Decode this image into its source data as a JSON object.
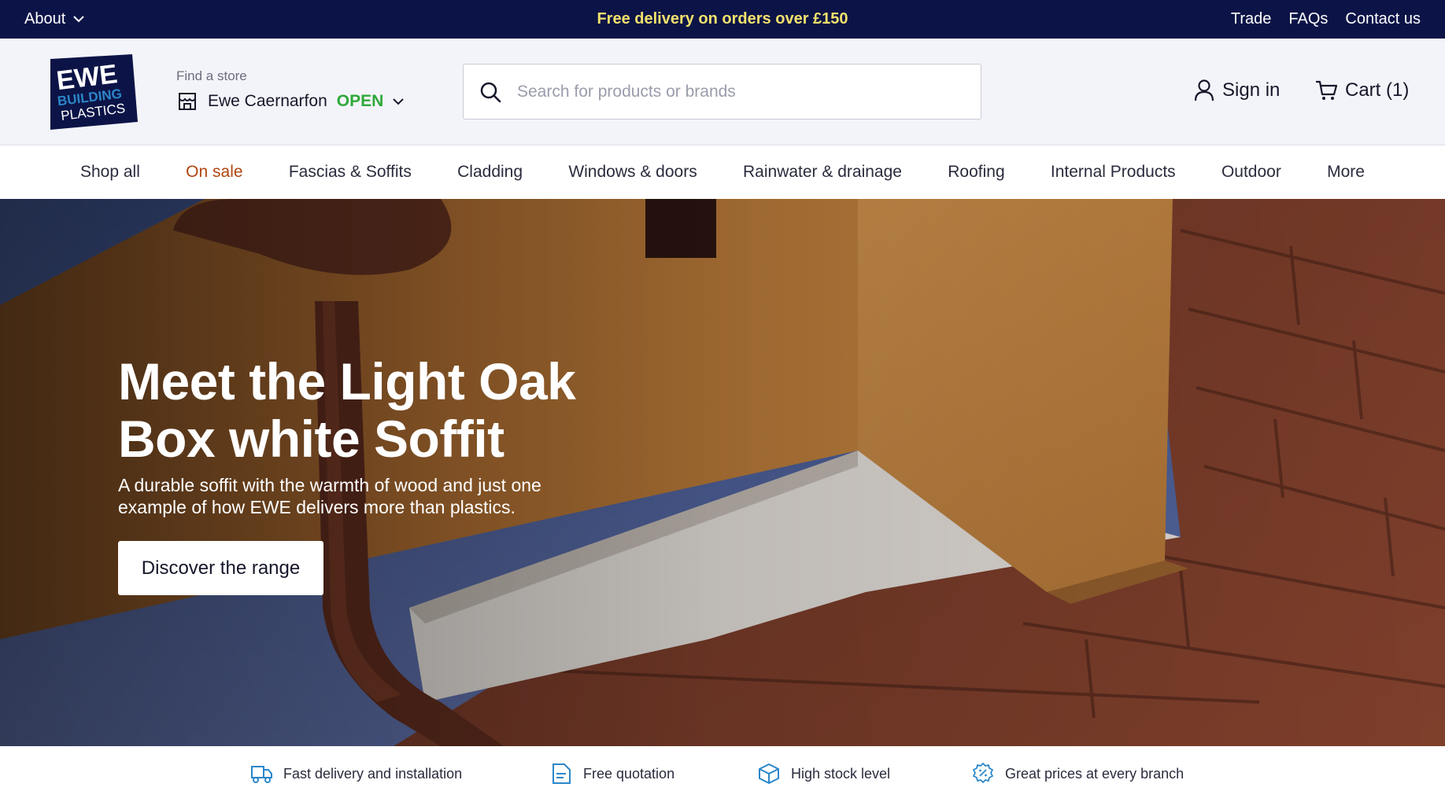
{
  "topbar": {
    "about_label": "About",
    "promo": "Free delivery on orders over £150",
    "links": [
      "Trade",
      "FAQs",
      "Contact us"
    ]
  },
  "header": {
    "logo": {
      "line1": "EWE",
      "line2": "BUILDING",
      "line3": "PLASTICS"
    },
    "store": {
      "label": "Find a store",
      "name": "Ewe Caernarfon",
      "status": "OPEN"
    },
    "search": {
      "placeholder": "Search for products or brands"
    },
    "sign_in": "Sign in",
    "cart": "Cart (1)"
  },
  "nav": {
    "items": [
      "Shop all",
      "On sale",
      "Fascias & Soffits",
      "Cladding",
      "Windows & doors",
      "Rainwater & drainage",
      "Roofing",
      "Internal Products",
      "Outdoor",
      "More"
    ]
  },
  "hero": {
    "title": "Meet the Light Oak Box white Soffit",
    "subtitle": "A durable soffit with the warmth of wood and just one example of how EWE delivers more than plastics.",
    "cta": "Discover the range"
  },
  "usps": [
    {
      "label": "Fast delivery and installation",
      "icon": "delivery-truck-icon"
    },
    {
      "label": "Free quotation",
      "icon": "quote-document-icon"
    },
    {
      "label": "High stock level",
      "icon": "box-icon"
    },
    {
      "label": "Great prices at every branch",
      "icon": "discount-badge-icon"
    }
  ],
  "colors": {
    "topbar_bg": "#0c1447",
    "promo_text": "#f2e16d",
    "open_status": "#2fa83a",
    "sale_link": "#b0450f",
    "usp_icon": "#2b86c9"
  }
}
